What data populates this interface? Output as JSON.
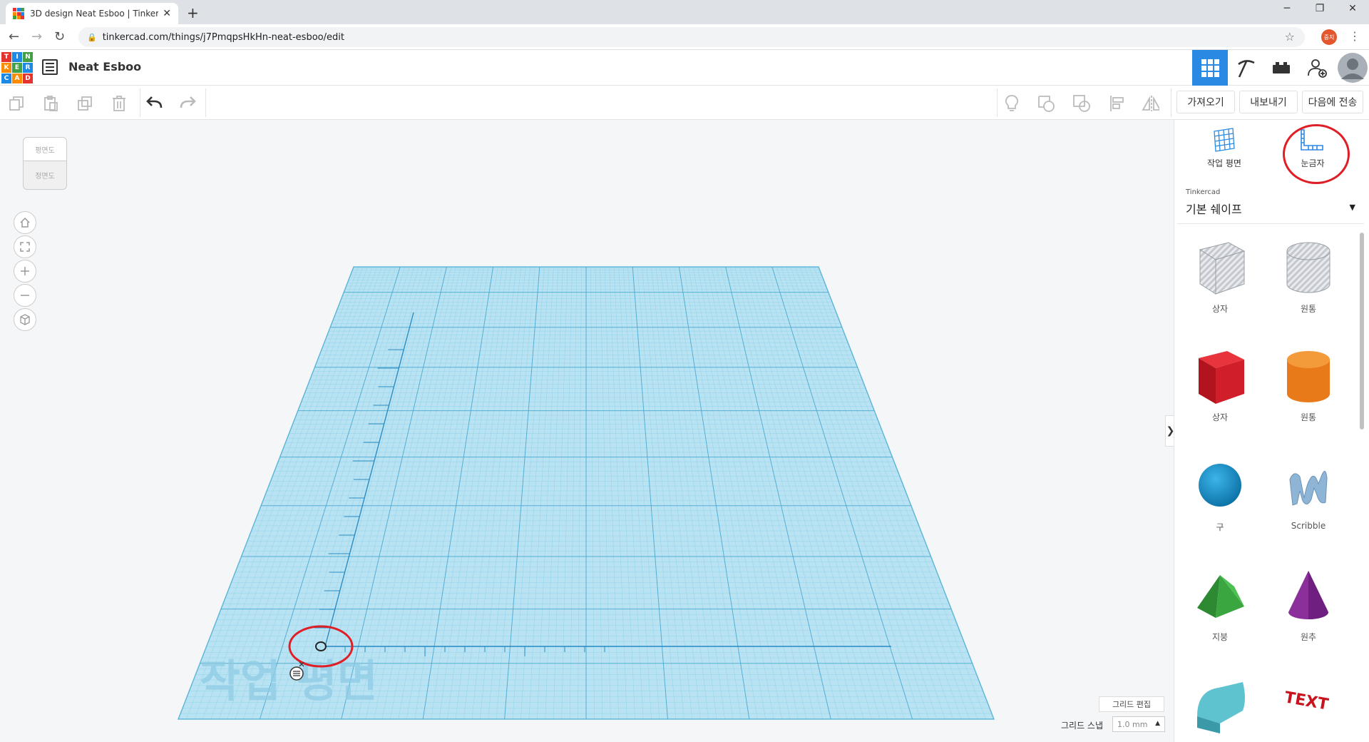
{
  "browser": {
    "tab_title": "3D design Neat Esboo | Tinkercad",
    "url": "tinkercad.com/things/j7PmqpsHkHn-neat-esboo/edit",
    "profile_badge": "중지"
  },
  "app": {
    "logo_letters": [
      "T",
      "I",
      "N",
      "K",
      "E",
      "R",
      "C",
      "A",
      "D"
    ],
    "project_title": "Neat Esboo"
  },
  "toolbar": {
    "import_label": "가져오기",
    "export_label": "내보내기",
    "send_label": "다음에 전송"
  },
  "viewcube": {
    "top_label": "평면도",
    "front_label": "정면도"
  },
  "workplane": {
    "watermark": "작업 평면"
  },
  "grid": {
    "edit_label": "그리드 편집",
    "snap_label": "그리드 스냅",
    "snap_value": "1.0 mm"
  },
  "panel": {
    "workplane_tool_label": "작업 평면",
    "ruler_tool_label": "눈금자",
    "library_source": "Tinkercad",
    "library_name": "기본 쉐이프",
    "shapes": [
      {
        "name": "상자",
        "icon": "box-hole-icon"
      },
      {
        "name": "원통",
        "icon": "cylinder-hole-icon"
      },
      {
        "name": "상자",
        "icon": "box-icon"
      },
      {
        "name": "원통",
        "icon": "cylinder-icon"
      },
      {
        "name": "구",
        "icon": "sphere-icon"
      },
      {
        "name": "Scribble",
        "icon": "scribble-icon"
      },
      {
        "name": "지붕",
        "icon": "roof-icon"
      },
      {
        "name": "원추",
        "icon": "cone-icon"
      },
      {
        "name": "",
        "icon": "round-roof-icon"
      },
      {
        "name": "",
        "icon": "text-icon",
        "text": "TEXT"
      }
    ]
  },
  "colors": {
    "accent": "#2a8ae3",
    "highlight_ring": "#e01e26",
    "workplane": "#a9dcef",
    "grid_line": "#5fb9db",
    "box_red": "#d01e2a",
    "cylinder_orange": "#e87a1a",
    "sphere_blue": "#1596d1",
    "roof_green": "#3aa63f",
    "cone_purple": "#8b2f9b"
  }
}
